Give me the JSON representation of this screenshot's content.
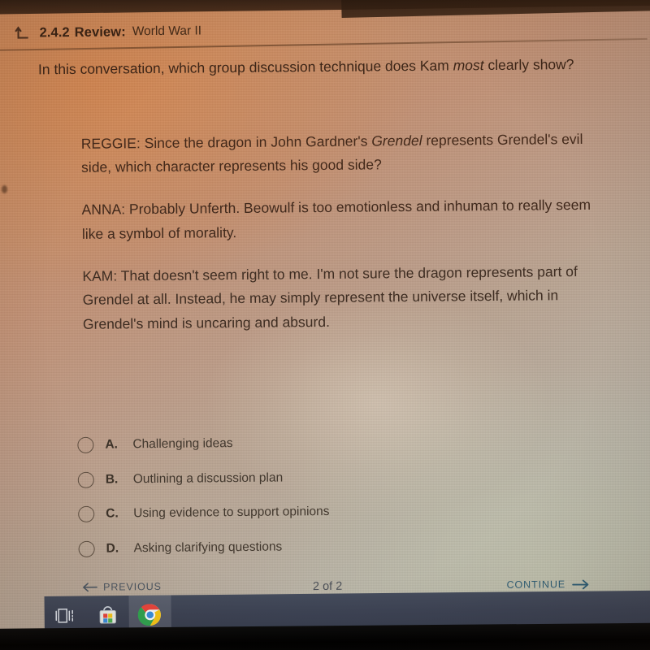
{
  "header": {
    "back_icon": "return-arrow-icon",
    "lesson_code": "2.4.2",
    "lesson_type": "Review:",
    "lesson_title": "World War II"
  },
  "question": {
    "prefix": "In this conversation, which group discussion technique does Kam ",
    "emphasis": "most",
    "suffix": " clearly show?"
  },
  "dialogue": [
    {
      "speaker": "REGGIE:",
      "part1": " Since the dragon in John Gardner's ",
      "italic": "Grendel",
      "part2": " represents Grendel's evil side, which character represents his good side?"
    },
    {
      "speaker": "ANNA:",
      "part1": " Probably Unferth. Beowulf is too emotionless and inhuman to really seem like a symbol of morality.",
      "italic": "",
      "part2": ""
    },
    {
      "speaker": "KAM:",
      "part1": " That doesn't seem right to me. I'm not sure the dragon represents part of Grendel at all. Instead, he may simply represent the universe itself, which in Grendel's mind is uncaring and absurd.",
      "italic": "",
      "part2": ""
    }
  ],
  "options": [
    {
      "letter": "A.",
      "text": "Challenging ideas",
      "selected": false
    },
    {
      "letter": "B.",
      "text": "Outlining a discussion plan",
      "selected": false
    },
    {
      "letter": "C.",
      "text": "Using evidence to support opinions",
      "selected": false
    },
    {
      "letter": "D.",
      "text": "Asking clarifying questions",
      "selected": false
    }
  ],
  "footer": {
    "previous_label": "PREVIOUS",
    "previous_icon": "arrow-left-icon",
    "page_indicator": "2 of 2",
    "continue_label": "CONTINUE",
    "continue_icon": "arrow-right-icon"
  },
  "taskbar": {
    "items": [
      {
        "icon": "microphone-icon",
        "name": "cortana-microphone",
        "active": false
      },
      {
        "icon": "task-view-icon",
        "name": "task-view",
        "active": false
      },
      {
        "icon": "microsoft-store-icon",
        "name": "microsoft-store",
        "active": false
      },
      {
        "icon": "google-chrome-icon",
        "name": "google-chrome",
        "active": true
      }
    ]
  },
  "colors": {
    "warm_background": "#c68b63",
    "cool_background": "#b4b2a6",
    "text_dark": "#3c2517",
    "continue_accent": "#2f5d74",
    "previous_muted": "#4b5560",
    "taskbar": "#3c4253"
  }
}
